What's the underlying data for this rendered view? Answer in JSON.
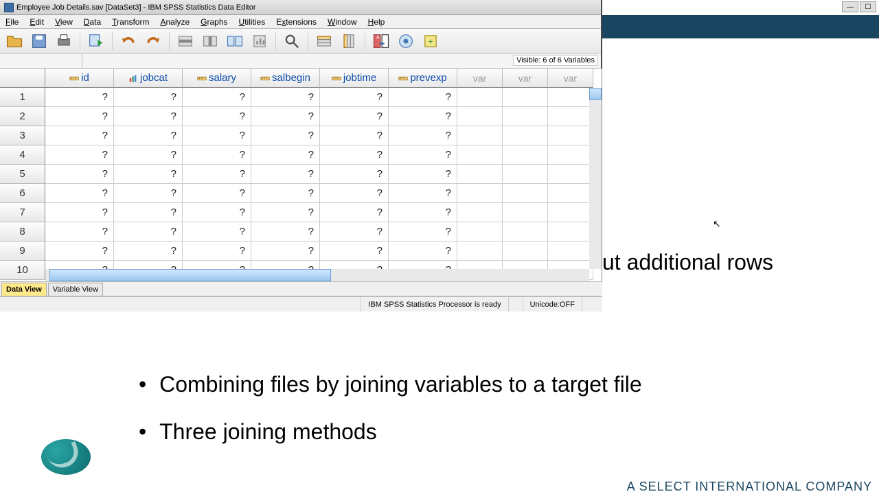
{
  "title": "Employee Job Details.sav [DataSet3] - IBM SPSS Statistics Data Editor",
  "menus": [
    "File",
    "Edit",
    "View",
    "Data",
    "Transform",
    "Analyze",
    "Graphs",
    "Utilities",
    "Extensions",
    "Window",
    "Help"
  ],
  "visible_text": "Visible: 6 of 6 Variables",
  "columns": [
    "id",
    "jobcat",
    "salary",
    "salbegin",
    "jobtime",
    "prevexp"
  ],
  "empty_var_label": "var",
  "rows": [
    1,
    2,
    3,
    4,
    5,
    6,
    7,
    8,
    9,
    10
  ],
  "cell_placeholder": "?",
  "tabs": {
    "data_view": "Data View",
    "variable_view": "Variable View"
  },
  "status": {
    "processor": "IBM SPSS Statistics Processor is ready",
    "unicode": "Unicode:OFF"
  },
  "slide": {
    "partial_row_text": "ut additional rows",
    "bullet2": "Combining files by joining variables to a target file",
    "bullet3": "Three joining methods",
    "footer": "A SELECT INTERNATIONAL COMPANY"
  },
  "icons": {
    "open": "open-folder-icon",
    "save": "save-disk-icon",
    "print": "print-icon",
    "recall": "recall-dialog-icon",
    "undo": "undo-icon",
    "redo": "redo-icon",
    "goto": "goto-case-icon",
    "gotovars": "goto-var-icon",
    "variables": "variables-icon",
    "run": "run-icon",
    "find": "find-icon",
    "insertc": "insert-cases-icon",
    "insertv": "insert-variable-icon",
    "split": "split-file-icon",
    "weight": "weight-icon",
    "select": "select-cases-icon",
    "value": "value-labels-icon"
  }
}
